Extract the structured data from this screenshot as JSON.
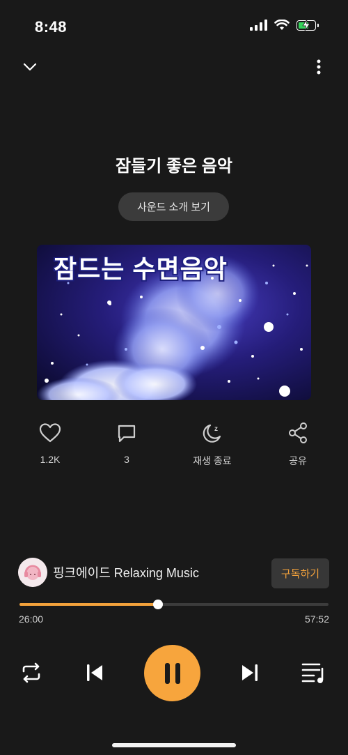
{
  "status_bar": {
    "time": "8:48"
  },
  "player": {
    "title": "잠들기 좋은 음악",
    "intro_button": "사운드 소개 보기",
    "artwork_text": "잠드는 수면음악"
  },
  "actions": [
    {
      "icon": "heart-icon",
      "label": "1.2K"
    },
    {
      "icon": "comment-icon",
      "label": "3"
    },
    {
      "icon": "moon-sleep-icon",
      "label": "재생 종료"
    },
    {
      "icon": "share-icon",
      "label": "공유"
    }
  ],
  "channel": {
    "name": "핑크에이드 Relaxing Music",
    "subscribe_label": "구독하기"
  },
  "progress": {
    "elapsed": "26:00",
    "total": "57:52",
    "fraction": 0.449
  },
  "colors": {
    "accent": "#f7a53d",
    "background": "#191919"
  }
}
